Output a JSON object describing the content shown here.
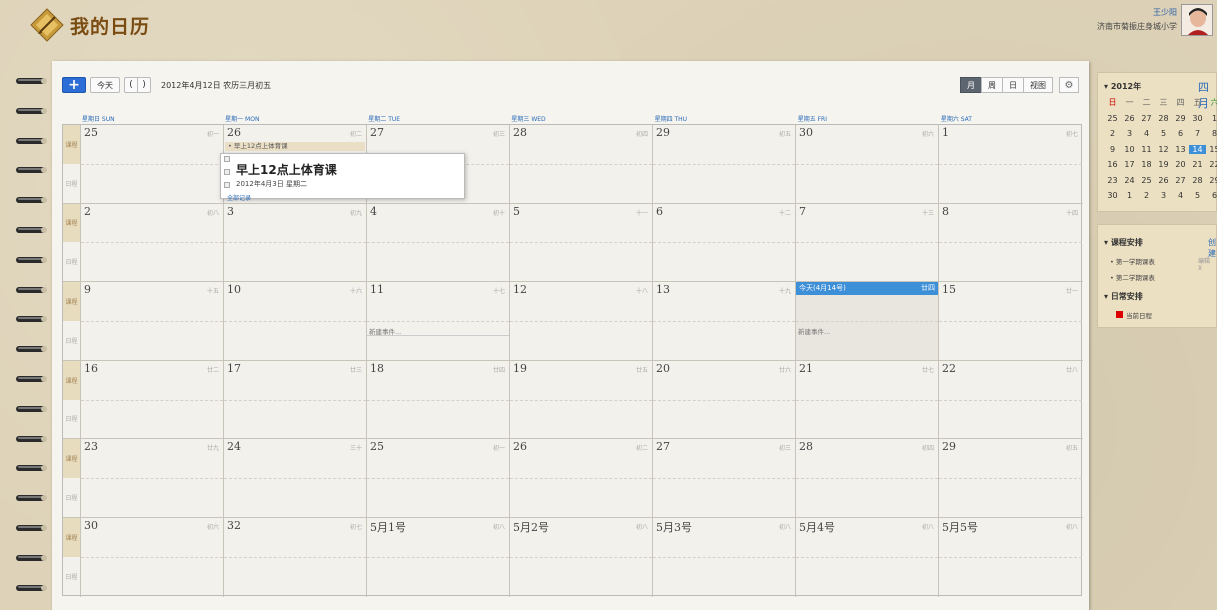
{
  "header": {
    "app_title": "我的日历",
    "user_name": "王少阳",
    "user_school": "济南市菊振庄身城小学"
  },
  "toolbar": {
    "add_label": "+",
    "today_label": "今天",
    "prev_label": "(",
    "next_label": ")",
    "current_date": "2012年4月12日 农历三月初五",
    "views": [
      {
        "label": "月",
        "active": true
      },
      {
        "label": "周",
        "active": false
      },
      {
        "label": "日",
        "active": false
      },
      {
        "label": "视图",
        "active": false
      }
    ],
    "gear_icon": "gear-icon"
  },
  "day_headers": [
    "星期日 SUN",
    "星期一 MON",
    "星期二 TUE",
    "星期三 WED",
    "星期四 THU",
    "星期五 FRI",
    "星期六 SAT"
  ],
  "row_labels": {
    "top": "课程",
    "bottom": "日程"
  },
  "weeks": [
    {
      "days": [
        {
          "d": "25",
          "l": "初一"
        },
        {
          "d": "26",
          "l": "初二"
        },
        {
          "d": "27",
          "l": "初三"
        },
        {
          "d": "28",
          "l": "初四"
        },
        {
          "d": "29",
          "l": "初五"
        },
        {
          "d": "30",
          "l": "初六"
        },
        {
          "d": "1",
          "l": "初七"
        }
      ]
    },
    {
      "days": [
        {
          "d": "2",
          "l": "初八"
        },
        {
          "d": "3",
          "l": "初九"
        },
        {
          "d": "4",
          "l": "初十"
        },
        {
          "d": "5",
          "l": "十一"
        },
        {
          "d": "6",
          "l": "十二"
        },
        {
          "d": "7",
          "l": "十三"
        },
        {
          "d": "8",
          "l": "十四"
        }
      ]
    },
    {
      "days": [
        {
          "d": "9",
          "l": "十五"
        },
        {
          "d": "10",
          "l": "十六"
        },
        {
          "d": "11",
          "l": "十七"
        },
        {
          "d": "12",
          "l": "十八"
        },
        {
          "d": "13",
          "l": "十九"
        },
        {
          "d": "今天(4月14号)",
          "l": "廿四"
        },
        {
          "d": "15",
          "l": "廿一"
        }
      ]
    },
    {
      "days": [
        {
          "d": "16",
          "l": "廿二"
        },
        {
          "d": "17",
          "l": "廿三"
        },
        {
          "d": "18",
          "l": "廿四"
        },
        {
          "d": "19",
          "l": "廿五"
        },
        {
          "d": "20",
          "l": "廿六"
        },
        {
          "d": "21",
          "l": "廿七"
        },
        {
          "d": "22",
          "l": "廿八"
        }
      ]
    },
    {
      "days": [
        {
          "d": "23",
          "l": "廿九"
        },
        {
          "d": "24",
          "l": "三十"
        },
        {
          "d": "25",
          "l": "初一"
        },
        {
          "d": "26",
          "l": "初二"
        },
        {
          "d": "27",
          "l": "初三"
        },
        {
          "d": "28",
          "l": "初四"
        },
        {
          "d": "29",
          "l": "初五"
        }
      ]
    },
    {
      "days": [
        {
          "d": "30",
          "l": "初六"
        },
        {
          "d": "32",
          "l": "初七"
        },
        {
          "d": "5月1号",
          "l": "初八"
        },
        {
          "d": "5月2号",
          "l": "初八"
        },
        {
          "d": "5月3号",
          "l": "初八"
        },
        {
          "d": "5月4号",
          "l": "初八"
        },
        {
          "d": "5月5号",
          "l": "初八"
        }
      ]
    }
  ],
  "event": {
    "label": "• 早上12点上体育课"
  },
  "new_event_label": "新建事件...",
  "popup": {
    "title": "早上12点上体育课",
    "date": "2012年4月3日 星期二",
    "more": "全部记录"
  },
  "mini_calendar": {
    "year": "2012年",
    "month": "四月",
    "weekdays": [
      "日",
      "一",
      "二",
      "三",
      "四",
      "五",
      "六"
    ],
    "rows": [
      [
        "25",
        "26",
        "27",
        "28",
        "29",
        "30",
        "1"
      ],
      [
        "2",
        "3",
        "4",
        "5",
        "6",
        "7",
        "8"
      ],
      [
        "9",
        "10",
        "11",
        "12",
        "13",
        "14",
        "15"
      ],
      [
        "16",
        "17",
        "18",
        "19",
        "20",
        "21",
        "22"
      ],
      [
        "23",
        "24",
        "25",
        "26",
        "27",
        "28",
        "29"
      ],
      [
        "30",
        "1",
        "2",
        "3",
        "4",
        "5",
        "6"
      ]
    ],
    "selected": "14"
  },
  "left_panel": {
    "course_header": "课程安排",
    "create_link": "创建",
    "course_items": [
      {
        "label": "第一学期课表",
        "edit": "编辑 X"
      },
      {
        "label": "第二学期课表",
        "edit": ""
      }
    ],
    "daily_header": "日常安排",
    "daily_items": [
      {
        "label": "当前日程",
        "color": "#dd0000"
      }
    ]
  }
}
